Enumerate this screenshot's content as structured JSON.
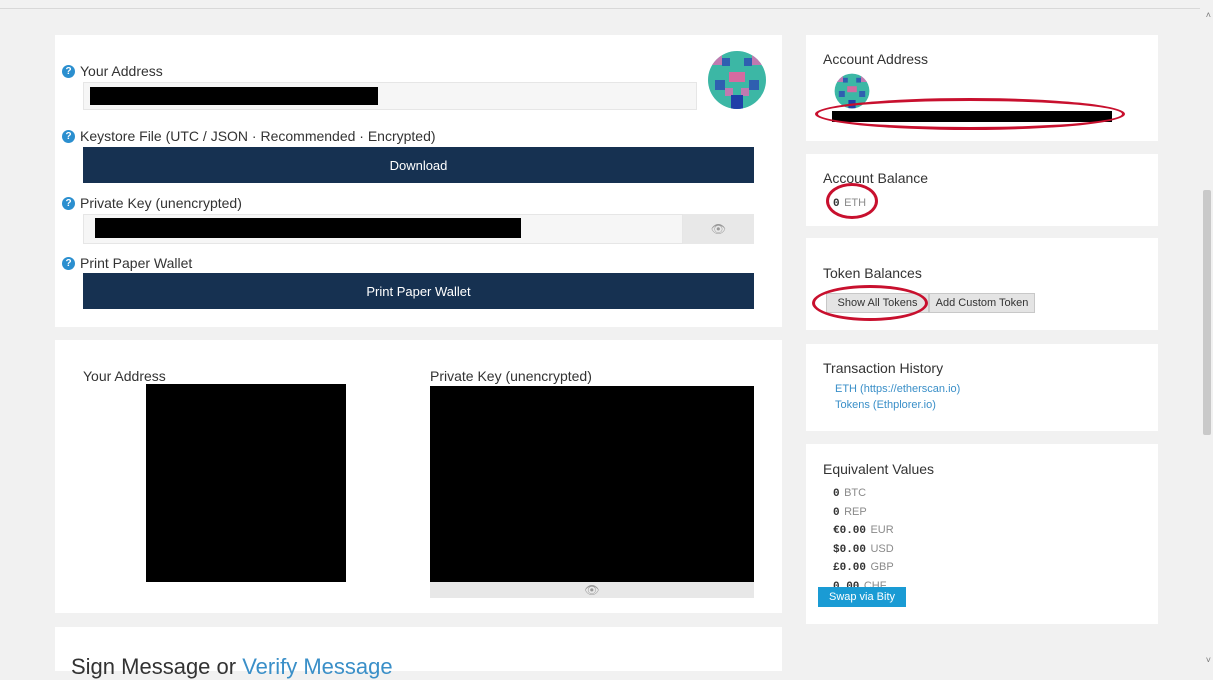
{
  "wallet": {
    "your_address_label": "Your Address",
    "keystore_label": "Keystore File (UTC / JSON · Recommended · Encrypted)",
    "download_button": "Download",
    "private_key_label": "Private Key (unencrypted)",
    "print_label": "Print Paper Wallet",
    "print_button": "Print Paper Wallet"
  },
  "paper": {
    "address_label": "Your Address",
    "private_key_label": "Private Key (unencrypted)"
  },
  "sign": {
    "prefix": "Sign Message or ",
    "link": "Verify Message"
  },
  "sidebar": {
    "account_address_title": "Account Address",
    "account_balance_title": "Account Balance",
    "balance_amount": "0",
    "balance_unit": "ETH",
    "token_balances_title": "Token Balances",
    "show_all_tokens": "Show All Tokens",
    "add_custom_token": "Add Custom Token",
    "tx_history_title": "Transaction History",
    "tx_links": [
      "ETH (https://etherscan.io)",
      "Tokens (Ethplorer.io)"
    ],
    "equiv_title": "Equivalent Values",
    "equiv": [
      {
        "amount": "0",
        "unit": "BTC"
      },
      {
        "amount": "0",
        "unit": "REP"
      },
      {
        "amount": "€0.00",
        "unit": "EUR"
      },
      {
        "amount": "$0.00",
        "unit": "USD"
      },
      {
        "amount": "£0.00",
        "unit": "GBP"
      },
      {
        "amount": "0.00",
        "unit": "CHF"
      }
    ],
    "swap_button": "Swap via Bity"
  },
  "colors": {
    "primary_dark": "#163151",
    "link": "#3a8fc8",
    "annotation_red": "#c8102e",
    "swap": "#1a9bd4"
  },
  "icons": {
    "help": "question-circle-icon",
    "eye": "eye-icon",
    "scroll_up": "scroll-up-arrow-icon",
    "scroll_down": "scroll-down-arrow-icon"
  }
}
